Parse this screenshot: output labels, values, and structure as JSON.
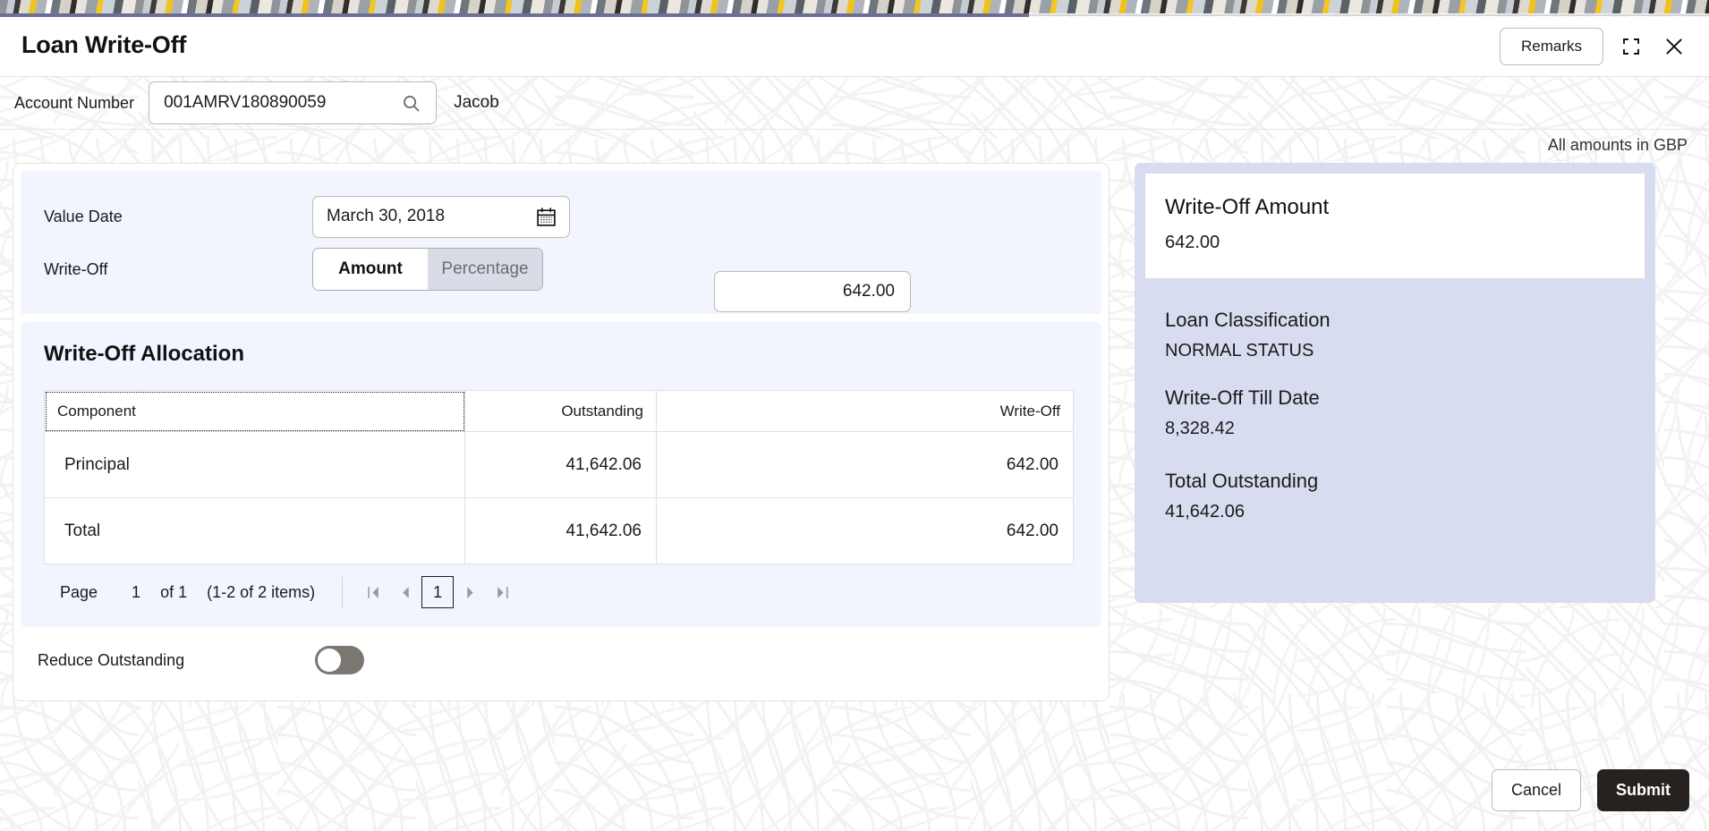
{
  "header": {
    "title": "Loan Write-Off",
    "remarks_label": "Remarks",
    "minimize_icon": "collapse-icon",
    "close_icon": "close-icon"
  },
  "account_bar": {
    "label": "Account Number",
    "value": "001AMRV180890059",
    "placeholder": "Account Number",
    "search_icon": "search-icon",
    "customer_name": "Jacob"
  },
  "currency_note": "All amounts in GBP",
  "form": {
    "value_date_label": "Value Date",
    "value_date_value": "March 30, 2018",
    "calendar_icon": "calendar-icon",
    "write_off_label": "Write-Off",
    "toggle_amount": "Amount",
    "toggle_percentage": "Percentage",
    "selected_mode": "Amount",
    "amount_value": "642.00"
  },
  "allocation": {
    "title": "Write-Off Allocation",
    "columns": [
      "Component",
      "Outstanding",
      "Write-Off"
    ],
    "rows": [
      {
        "component": "Principal",
        "outstanding": "41,642.06",
        "write_off": "642.00"
      },
      {
        "component": "Total",
        "outstanding": "41,642.06",
        "write_off": "642.00"
      }
    ],
    "pager": {
      "page_label": "Page",
      "page_number": "1",
      "of_label": "of 1",
      "items_label": "(1-2 of 2 items)",
      "first_icon": "first-page-icon",
      "prev_icon": "previous-page-icon",
      "current_page": "1",
      "next_icon": "next-page-icon",
      "last_icon": "last-page-icon"
    }
  },
  "reduce_outstanding": {
    "label": "Reduce Outstanding",
    "state": "off"
  },
  "summary": {
    "hero_title": "Write-Off Amount",
    "hero_value": "642.00",
    "items": [
      {
        "label": "Loan Classification",
        "value": "NORMAL STATUS"
      },
      {
        "label": "Write-Off Till Date",
        "value": "8,328.42"
      },
      {
        "label": "Total Outstanding",
        "value": "41,642.06"
      }
    ]
  },
  "footer": {
    "cancel_label": "Cancel",
    "submit_label": "Submit"
  },
  "colors": {
    "panel_bg": "#f2f5fd",
    "summary_bg": "#d8dcf0",
    "submit_bg": "#272220",
    "toggle_off": "#7d7771",
    "progress": "#6b6f96"
  }
}
